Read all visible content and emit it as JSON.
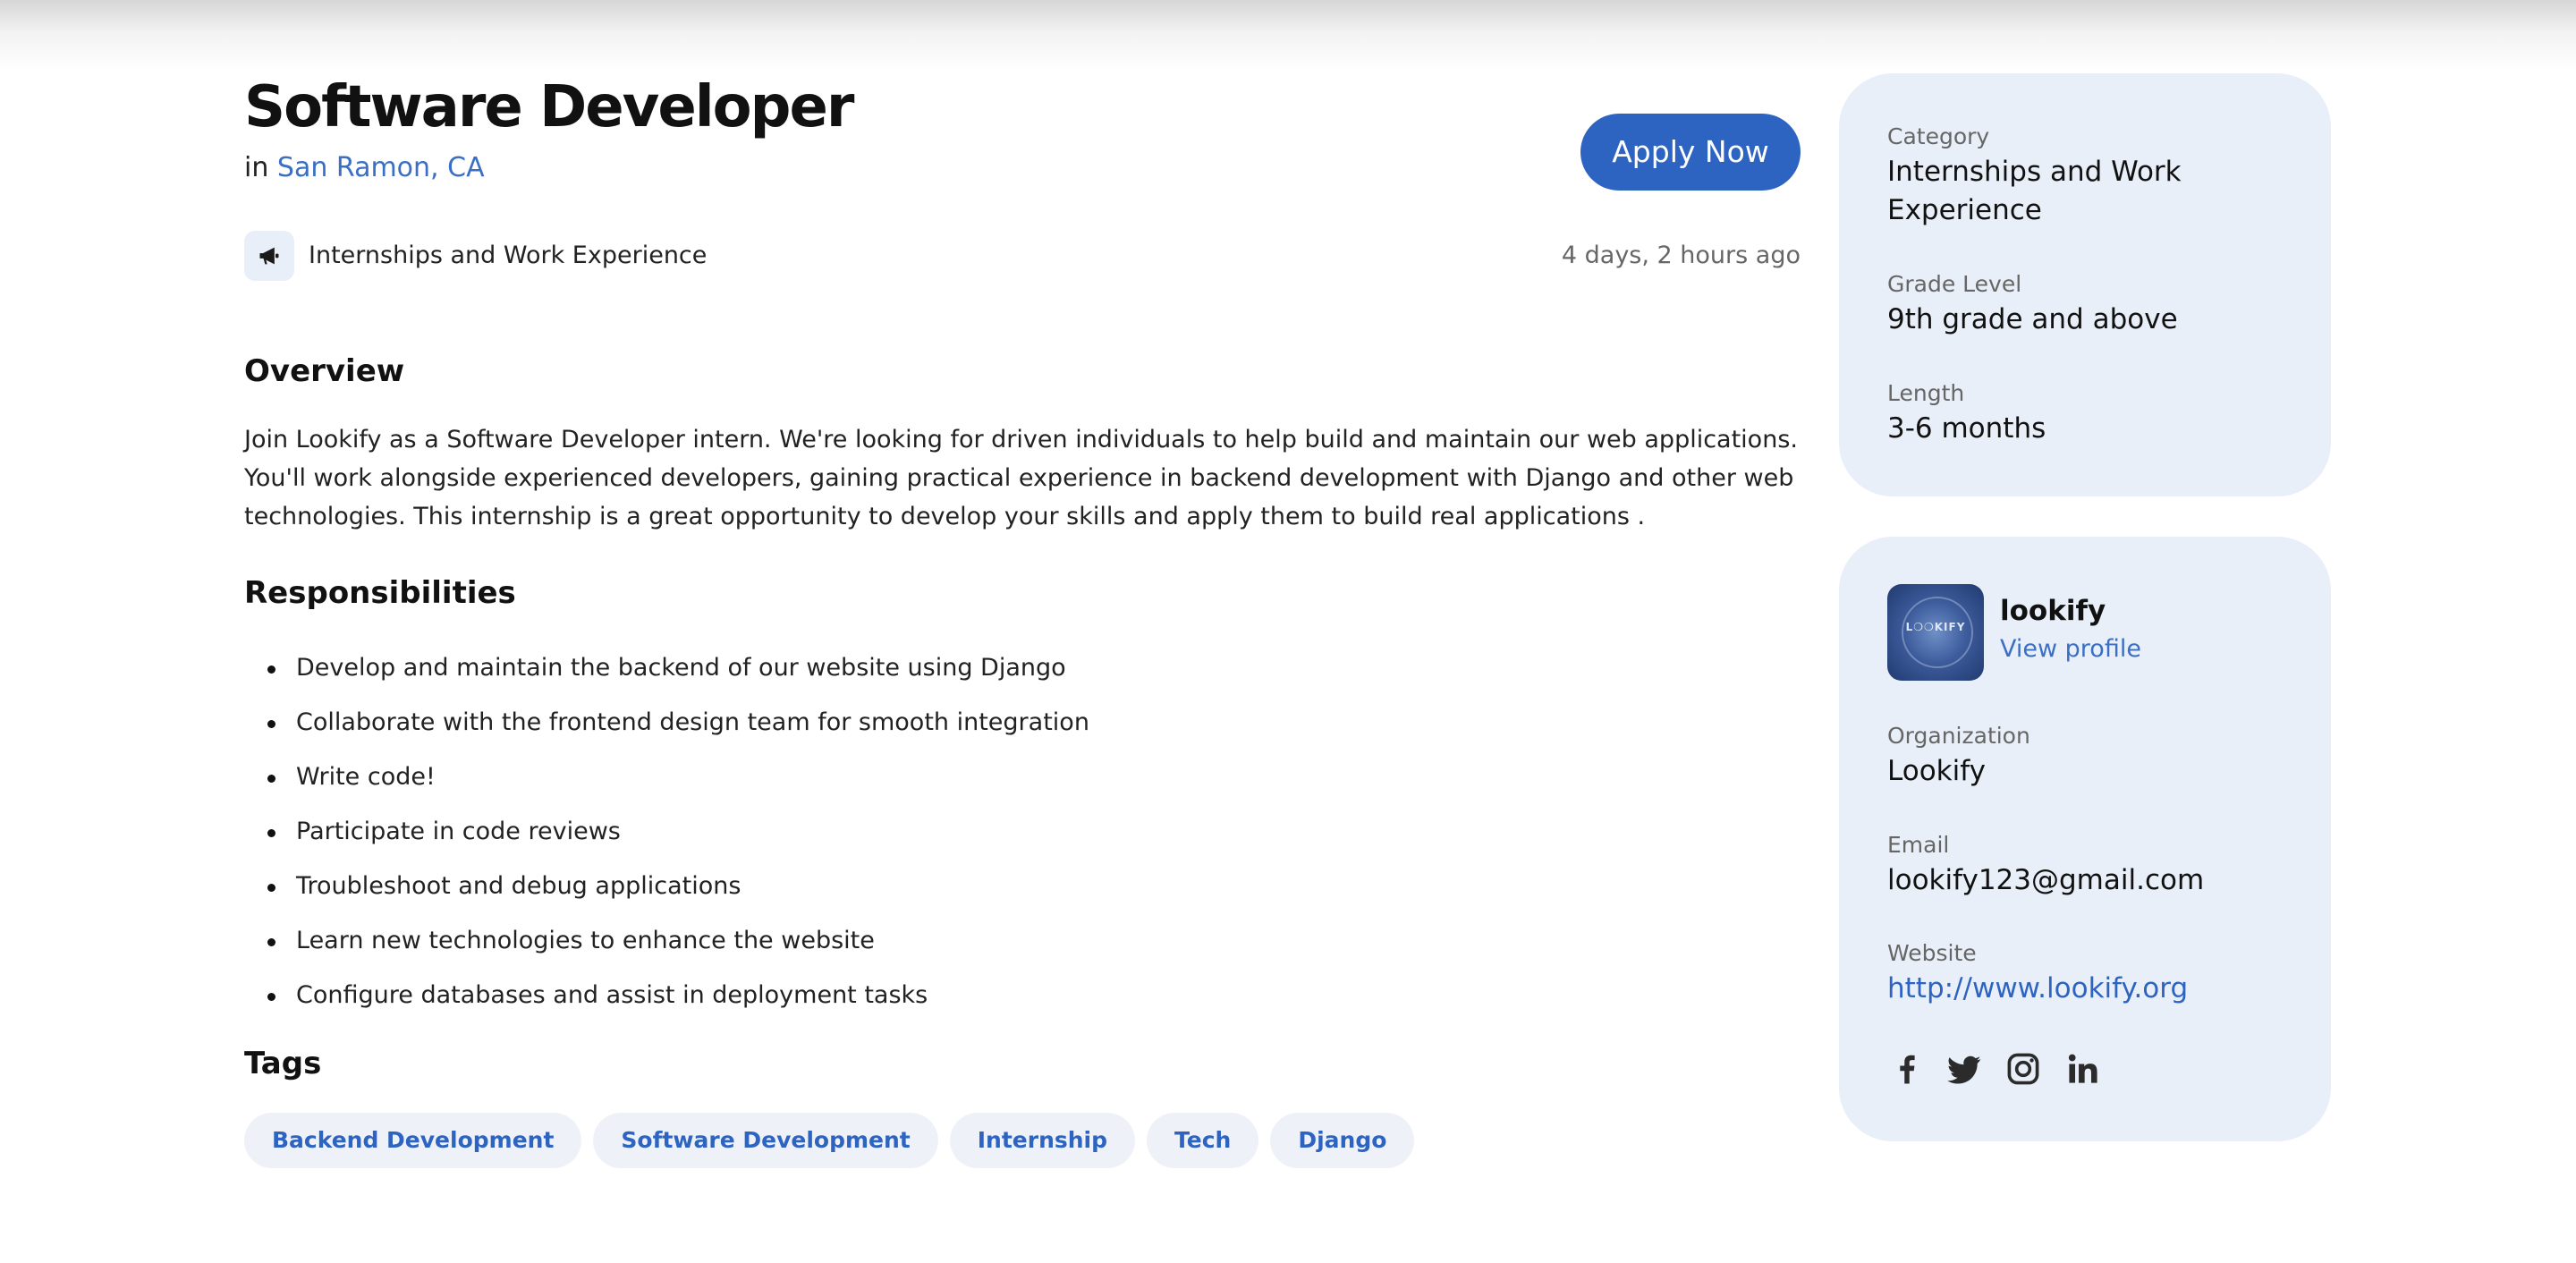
{
  "job": {
    "title": "Software Developer",
    "location_prefix": "in",
    "location": "San Ramon, CA",
    "apply_label": "Apply Now",
    "category": "Internships and Work Experience",
    "posted": "4 days, 2 hours ago"
  },
  "overview": {
    "heading": "Overview",
    "text": "Join Lookify as a Software Developer intern. We're looking for driven individuals to help build and maintain our web applications. You'll work alongside experienced developers, gaining practical experience in backend development with Django and other web technologies. This internship is a great opportunity to develop your skills and apply them to build real applications ."
  },
  "responsibilities": {
    "heading": "Responsibilities",
    "items": [
      "Develop and maintain the backend of our website using Django",
      "Collaborate with the frontend design team for smooth integration",
      "Write code!",
      "Participate in code reviews",
      "Troubleshoot and debug applications",
      "Learn new technologies to enhance the website",
      "Configure databases and assist in deployment tasks"
    ]
  },
  "tags": {
    "heading": "Tags",
    "items": [
      "Backend Development",
      "Software Development",
      "Internship",
      "Tech",
      "Django"
    ]
  },
  "details": {
    "category_label": "Category",
    "category_value": "Internships and Work Experience",
    "grade_label": "Grade Level",
    "grade_value": "9th grade and above",
    "length_label": "Length",
    "length_value": "3-6 months"
  },
  "organization": {
    "name": "lookify",
    "view_profile": "View profile",
    "org_label": "Organization",
    "org_value": "Lookify",
    "email_label": "Email",
    "email_value": "lookify123@gmail.com",
    "website_label": "Website",
    "website_value": "http://www.lookify.org",
    "logo_text": "L❍❍KIFY",
    "social": [
      "facebook-icon",
      "twitter-icon",
      "instagram-icon",
      "linkedin-icon"
    ]
  },
  "colors": {
    "accent": "#2e64c1",
    "link": "#3b6fc4",
    "card_bg": "#e8eff8",
    "tag_bg": "#eef2f8"
  }
}
